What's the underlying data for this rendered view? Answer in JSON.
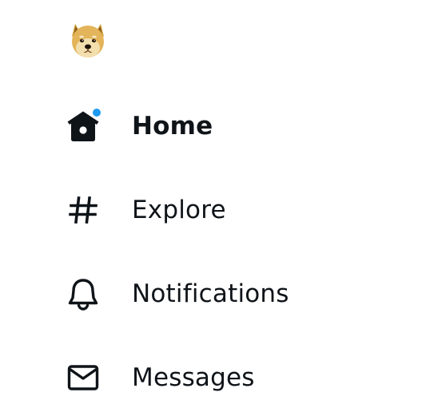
{
  "logo": {
    "icon": "doge-avatar-icon",
    "alt": "Doge"
  },
  "nav": {
    "items": [
      {
        "label": "Home",
        "icon": "home-icon",
        "active": true,
        "has_notification_dot": true
      },
      {
        "label": "Explore",
        "icon": "hashtag-icon",
        "active": false
      },
      {
        "label": "Notifications",
        "icon": "bell-icon",
        "active": false
      },
      {
        "label": "Messages",
        "icon": "envelope-icon",
        "active": false
      }
    ]
  },
  "colors": {
    "text": "#0f1419",
    "badge": "#1d9bf0",
    "background": "#ffffff"
  }
}
